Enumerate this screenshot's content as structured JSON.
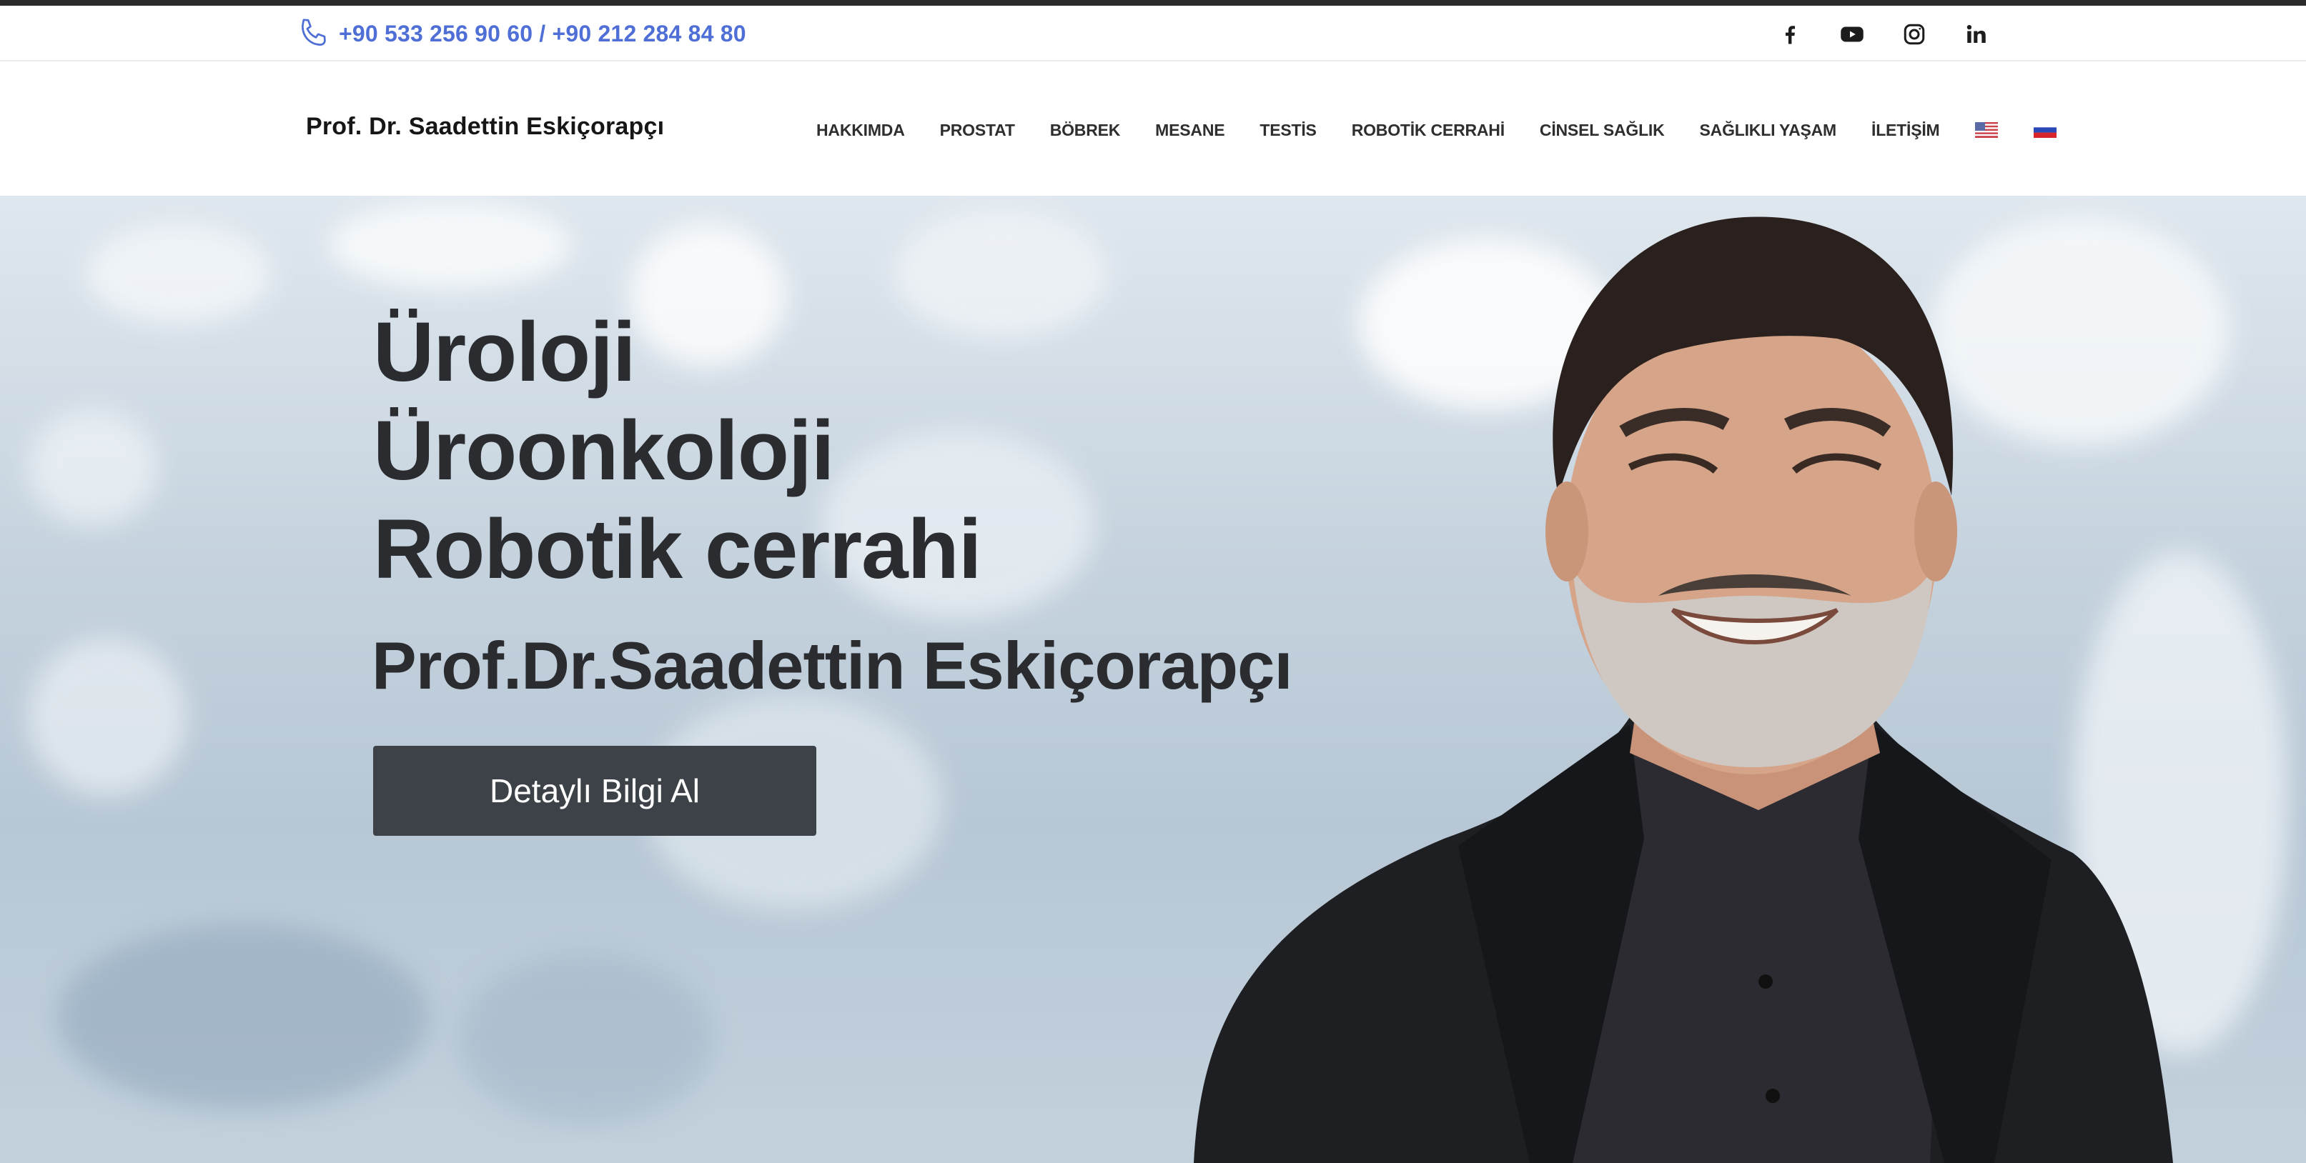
{
  "topbar": {
    "phone": "+90 533 256 90 60 / +90 212 284 84 80",
    "socials": [
      "facebook-icon",
      "youtube-icon",
      "instagram-icon",
      "linkedin-icon"
    ]
  },
  "header": {
    "brand": "Prof. Dr. Saadettin Eskiçorapçı",
    "nav": [
      "HAKKIMDA",
      "PROSTAT",
      "BÖBREK",
      "MESANE",
      "TESTİS",
      "ROBOTİK CERRAHİ",
      "CİNSEL SAĞLIK",
      "SAĞLIKLI YAŞAM",
      "İLETİŞİM"
    ],
    "flags": [
      "us-flag-icon",
      "ru-flag-icon"
    ]
  },
  "hero": {
    "lines": [
      "Üroloji",
      "Üroonkoloji",
      "Robotik cerrahi"
    ],
    "name": "Prof.Dr.Saadettin Eskiçorapçı",
    "cta": "Detaylı Bilgi Al"
  },
  "colors": {
    "accent": "#4f6fd6",
    "text_dark": "#2a2c30",
    "button": "#3c4248"
  }
}
